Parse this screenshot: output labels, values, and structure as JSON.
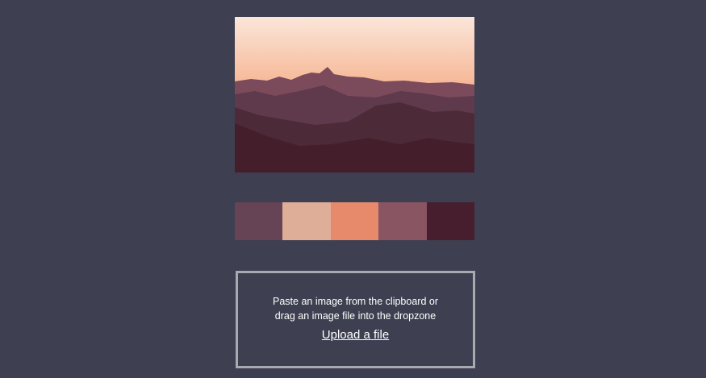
{
  "image": {
    "subject": "sunset-mountains",
    "colors": {
      "sky_top": "#fbe6da",
      "sky_mid": "#f6b694",
      "sky_low": "#e98a6c",
      "horizon": "#c8675f",
      "ridge_far": "#7b4a5b",
      "ridge_mid": "#5f3a4c",
      "ridge_near": "#4d2a38",
      "ridge_front": "#451e2c"
    }
  },
  "palette": {
    "swatches": [
      "#664355",
      "#dfae99",
      "#e78a6c",
      "#8a5562",
      "#471e2d"
    ]
  },
  "dropzone": {
    "line1": "Paste an image from the clipboard or",
    "line2": "drag an image file into the dropzone",
    "upload_label": "Upload a file"
  }
}
